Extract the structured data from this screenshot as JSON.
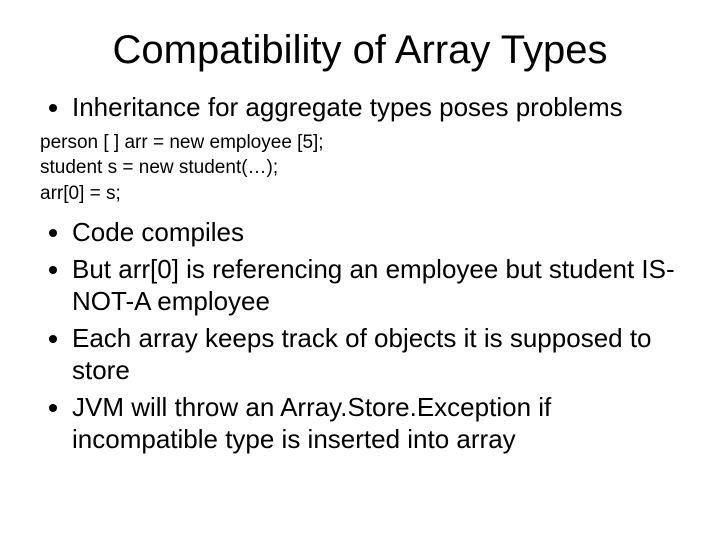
{
  "title": "Compatibility of Array Types",
  "bullets_a": {
    "0": "Inheritance for aggregate types poses problems"
  },
  "code": {
    "0": "person [ ] arr = new employee [5];",
    "1": "student s = new student(…);",
    "2": "arr[0] =  s;"
  },
  "bullets_b": {
    "0": "Code compiles",
    "1": "But arr[0] is referencing an employee but student IS-NOT-A employee",
    "2": "Each array keeps track of objects it is supposed to store",
    "3": "JVM will throw an Array.Store.Exception if incompatible type is inserted into array"
  }
}
